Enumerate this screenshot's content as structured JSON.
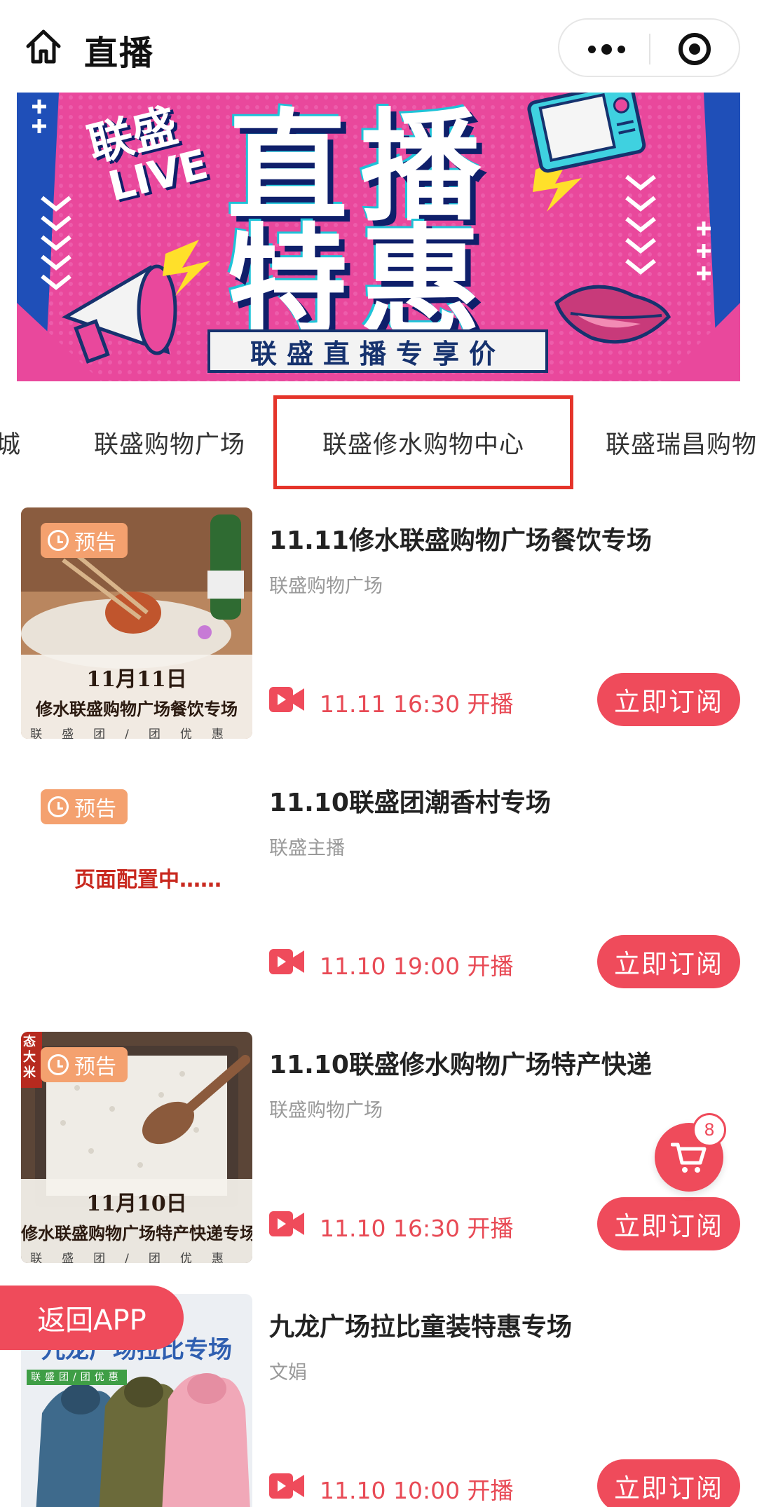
{
  "header": {
    "title": "直播"
  },
  "banner": {
    "logo_text": "联盛",
    "live_text": "LIVE",
    "title_line1": "直播",
    "title_line2": "特惠",
    "subtitle": "联盛直播专享价"
  },
  "tabs": [
    {
      "label": "城"
    },
    {
      "label": "联盛购物广场"
    },
    {
      "label": "联盛修水购物中心"
    },
    {
      "label": "联盛瑞昌购物"
    }
  ],
  "list": [
    {
      "title": "11.11修水联盛购物广场餐饮专场",
      "host": "联盛购物广场",
      "badge": "预告",
      "start_time": "11.11 16:30 开播",
      "button": "立即订阅",
      "caption_date": "11月11日",
      "caption_name": "修水联盛购物广场餐饮专场",
      "caption_tag": "联盛团/团优惠"
    },
    {
      "title": "11.10联盛团潮香村专场",
      "host": "联盛主播",
      "badge": "预告",
      "placeholder": "页面配置中……",
      "start_time": "11.10 19:00 开播",
      "button": "立即订阅"
    },
    {
      "title": "11.10联盛修水购物广场特产快递",
      "host": "联盛购物广场",
      "badge": "预告",
      "start_time": "11.10 16:30 开播",
      "button": "立即订阅",
      "caption_date": "11月10日",
      "caption_name": "修水联盛购物广场特产快递专场",
      "caption_tag": "联盛团/团优惠",
      "corner_text": "态大米"
    },
    {
      "title": "九龙广场拉比童装特惠专场",
      "host": "文娟",
      "start_time": "11.10 10:00 开播",
      "button": "立即订阅",
      "caption_name": "九龙广场拉比专场",
      "caption_tag": "联盛团/团优惠"
    }
  ],
  "cart": {
    "count": "8"
  },
  "back_app": {
    "label": "返回APP"
  },
  "colors": {
    "accent": "#ef4b5b",
    "badge": "#f4a16f",
    "active_tab_border": "#e5342a"
  }
}
